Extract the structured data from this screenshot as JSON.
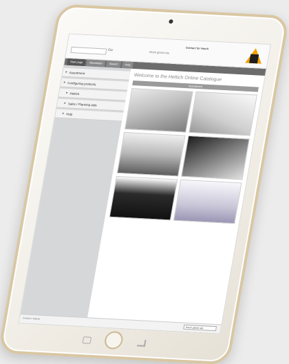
{
  "header": {
    "contact": "Contact for Hetch",
    "go": "Go",
    "link": "Hetch global site"
  },
  "nav": {
    "tabs": [
      "Start page",
      "Newsletter",
      "Search",
      "Help"
    ]
  },
  "sidebar": {
    "items": [
      {
        "label": "Assortment",
        "indent": false
      },
      {
        "label": "Configuring products",
        "indent": false
      },
      {
        "label": "Hettich",
        "indent": true
      },
      {
        "label": "Sales / Planning aids",
        "indent": true
      },
      {
        "label": "Help",
        "indent": true
      }
    ]
  },
  "main": {
    "title": "Welcome to the Hettich Online Catalogue",
    "subtitle": "Assortment"
  },
  "footer": {
    "text": "Contact / Imprint",
    "select": "Hetch global site"
  },
  "colors": {
    "logo_orange": "#f5a100",
    "logo_dark": "#1e1e1e",
    "frame_gold": "#d9c7a3"
  }
}
